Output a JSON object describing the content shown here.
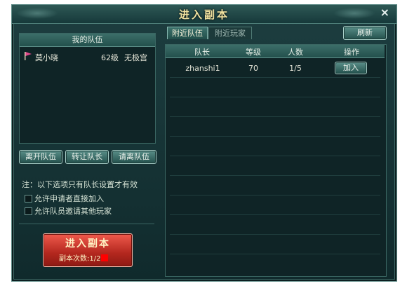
{
  "window": {
    "title": "进入副本",
    "close_glyph": "×"
  },
  "my_team": {
    "header": "我的队伍",
    "members": [
      {
        "name": "莫小晓",
        "level": "62级",
        "class": "无极宫"
      }
    ]
  },
  "team_buttons": {
    "leave": "离开队伍",
    "transfer": "转让队长",
    "kick": "请离队伍"
  },
  "options": {
    "note": "注：以下选项只有队长设置才有效",
    "allow_join": "允许申请者直接加入",
    "allow_invite": "允许队员邀请其他玩家"
  },
  "enter": {
    "label": "进入副本",
    "count_label": "副本次数:",
    "count": "1/2"
  },
  "tabs": {
    "nearby_teams": "附近队伍",
    "nearby_players": "附近玩家"
  },
  "refresh_label": "刷新",
  "table": {
    "headers": {
      "leader": "队长",
      "level": "等级",
      "count": "人数",
      "action": "操作"
    },
    "rows": [
      {
        "leader": "zhanshi1",
        "level": "70",
        "count": "1/5",
        "action": "加入"
      }
    ]
  },
  "colors": {
    "accent_red": "#c8342a",
    "count_marker": "#ff0000"
  }
}
